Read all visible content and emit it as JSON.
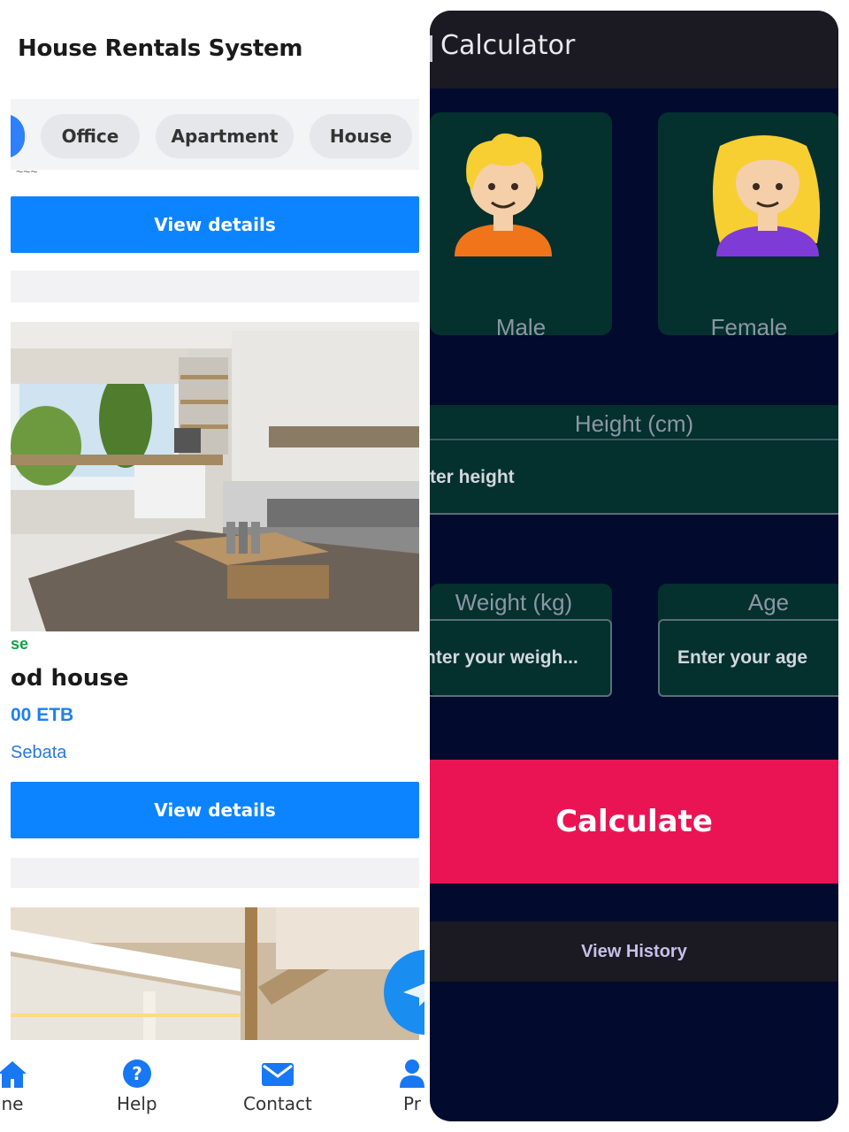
{
  "rentals": {
    "app_title": "House Rentals System",
    "filters": [
      "Office",
      "Apartment",
      "House"
    ],
    "view_details_label": "View details",
    "listing": {
      "type_tag": "se",
      "name": "od house",
      "price": "00 ETB",
      "location": "Sebata"
    },
    "bottom_nav": [
      {
        "label": "ne",
        "icon": "home-icon"
      },
      {
        "label": "Help",
        "icon": "help-icon"
      },
      {
        "label": "Contact",
        "icon": "mail-icon"
      },
      {
        "label": "Pr",
        "icon": "profile-icon"
      }
    ],
    "colors": {
      "primary": "#0d84ff",
      "tag_green": "#13a14a",
      "price_blue": "#1f7ff0"
    }
  },
  "calculator": {
    "title": "Calculator",
    "gender_options": [
      {
        "label": "Male",
        "icon": "person-emoji-icon"
      },
      {
        "label": "Female",
        "icon": "woman-emoji-icon"
      }
    ],
    "height_label": "Height (cm)",
    "height_placeholder": "ter height",
    "weight_label": "Weight (kg)",
    "weight_placeholder": "nter your weigh...",
    "age_label": "Age",
    "age_placeholder": "Enter your age",
    "calculate_label": "Calculate",
    "history_label": "View History",
    "colors": {
      "background": "#020b2e",
      "card": "#04302e",
      "accent": "#ea1454"
    }
  }
}
